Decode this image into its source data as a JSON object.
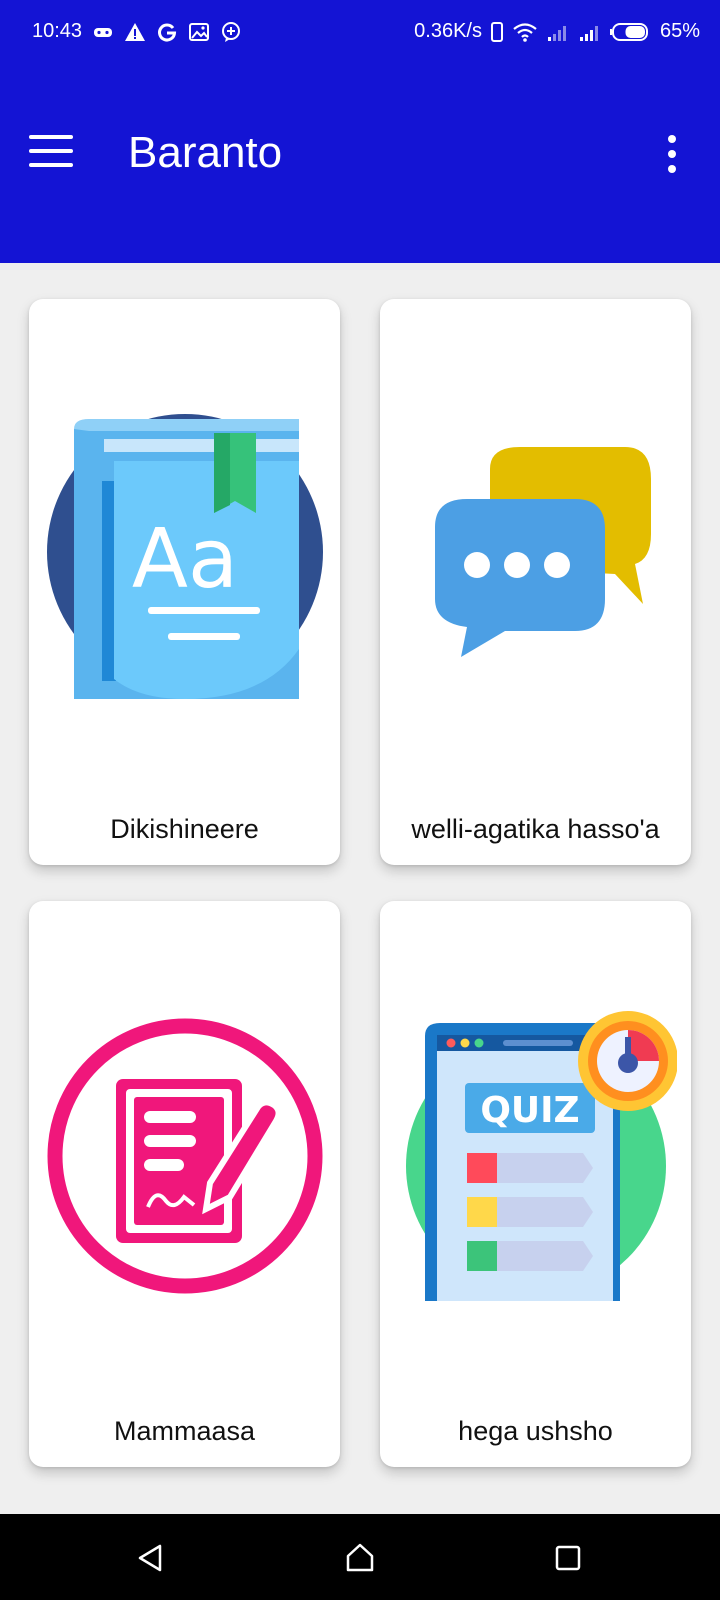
{
  "status_bar": {
    "time": "10:43",
    "left_icons": [
      "game-controller-icon",
      "alert-icon",
      "google-icon",
      "image-icon",
      "chat-plus-icon"
    ],
    "network_speed": "0.36K/s",
    "battery_percent": "65%",
    "battery_level": 0.65
  },
  "app_bar": {
    "title": "Baranto",
    "background_color": "#1414d4",
    "menu_icon": "hamburger-menu-icon",
    "overflow_icon": "more-vert-icon"
  },
  "cards": [
    {
      "label": "Dikishineere",
      "icon": "dictionary-book-icon"
    },
    {
      "label": "welli-agatika hasso'a",
      "icon": "chat-bubbles-icon"
    },
    {
      "label": "Mammaasa",
      "icon": "document-sign-icon"
    },
    {
      "label": "hega ushsho",
      "icon": "quiz-icon"
    }
  ],
  "card_texts": {
    "book_glyph": "Aa",
    "quiz_glyph": "QUIZ"
  },
  "nav_bar": {
    "buttons": [
      "back-icon",
      "home-icon",
      "recents-icon"
    ]
  }
}
